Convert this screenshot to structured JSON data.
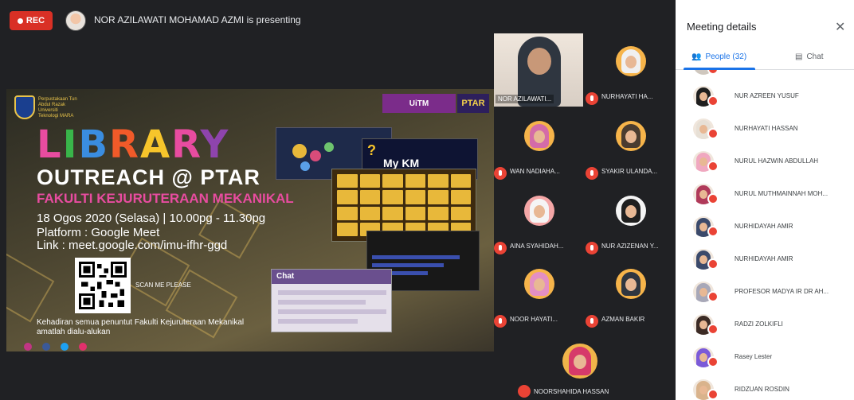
{
  "recording": {
    "label": "REC"
  },
  "presenter": {
    "text": "NOR AZILAWATI MOHAMAD AZMI is presenting"
  },
  "slide": {
    "title_letters": [
      "L",
      "I",
      "B",
      "R",
      "A",
      "R",
      "Y"
    ],
    "outreach": "OUTREACH @ PTAR",
    "fakulti": "FAKULTI KEJURUTERAAN MEKANIKAL",
    "date_line": "18 Ogos 2020 (Selasa) | 10.00pg - 11.30pg",
    "platform_line": "Platform : Google Meet",
    "link_line": "Link : meet.google.com/imu-ifhr-ggd",
    "scan_label": "SCAN ME PLEASE",
    "invite_text": "Kehadiran semua penuntut Fakulti Kejuruteraan Mekanikal amatlah dialu-alukan",
    "badge_left": "UiTM",
    "badge_right": "PTAR",
    "mykm": "My KM",
    "chat_label": "Chat",
    "uitm_logo_text": "Perpustakaan Tun Abdul Razak Universiti Teknologi MARA"
  },
  "tiles": [
    {
      "name": "NOR AZILAWATI...",
      "self": true
    },
    {
      "name": "NURHAYATI HA...",
      "hijab": "#f0f0f0",
      "bg": "#f6b44a"
    },
    {
      "name": "WAN NADIAHA...",
      "hijab": "#d46ba8",
      "bg": "#f6b44a"
    },
    {
      "name": "SYAKIR ULANDA...",
      "hijab": "#4a3c30",
      "bg": "#f6b44a"
    },
    {
      "name": "AINA SYAHIDAH...",
      "hijab": "#f5f5f5",
      "bg": "#f6b44a"
    },
    {
      "name": "NUR AZIZENAN Y...",
      "hijab": "#1f1f1f",
      "bg": "#f6b44a"
    },
    {
      "name": "NOOR HAYATI...",
      "hijab": "#e38fc4",
      "bg": "#f6b44a"
    },
    {
      "name": "AZMAN BAKIR",
      "hijab": "#2f3640",
      "bg": "#f6b44a"
    }
  ],
  "bottom_tile": {
    "name": "NOORSHAHIDA HASSAN"
  },
  "panel": {
    "title": "Meeting details",
    "tab_people": "People (32)",
    "tab_chat": "Chat",
    "participants": [
      {
        "name": "NUR AZREEN YUSUF",
        "hijab": "#1f1f1f"
      },
      {
        "name": "NURHAYATI HASSAN",
        "hijab": "#e7e0d6"
      },
      {
        "name": "NURUL HAZWIN ABDULLAH",
        "hijab": "#f0a8c0"
      },
      {
        "name": "NURUL MUTHMAINNAH MOH...",
        "hijab": "#b03a5a"
      },
      {
        "name": "NURHIDAYAH AMIR",
        "hijab": "#3b4a6b"
      },
      {
        "name": "NURHIDAYAH AMIR",
        "hijab": "#3b4a6b"
      },
      {
        "name": "PROFESOR MADYA IR DR AH...",
        "hijab": "#a8a8b8"
      },
      {
        "name": "RADZI ZOLKIFLI",
        "hijab": "#3c2b25"
      },
      {
        "name": "Rasey Lester",
        "hijab": "#7b5ad8"
      },
      {
        "name": "RIDZUAN ROSDIN",
        "hijab": "#d9b38c"
      }
    ]
  }
}
